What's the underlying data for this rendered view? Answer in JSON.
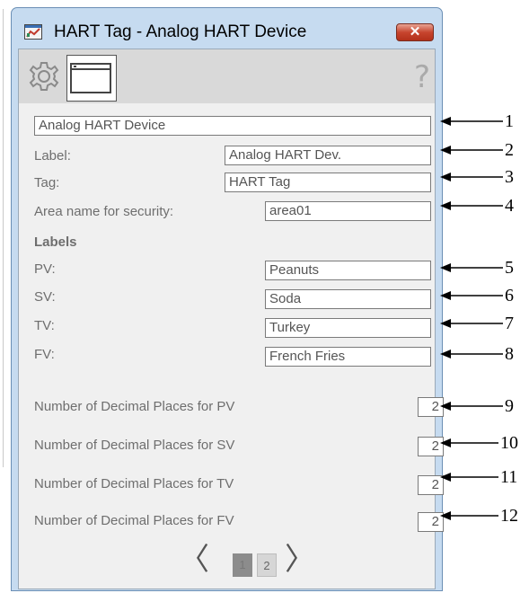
{
  "window": {
    "title": "HART Tag - Analog HART Device",
    "close_label": "✕"
  },
  "toolbar": {
    "gear_icon": "gear-icon",
    "window_icon": "window-icon",
    "help_label": "?"
  },
  "form": {
    "description": "Analog HART Device",
    "label_caption": "Label:",
    "label_value": "Analog HART Dev.",
    "tag_caption": "Tag:",
    "tag_value": "HART Tag",
    "area_caption": "Area name for security:",
    "area_value": "area01",
    "labels_heading": "Labels",
    "pv_caption": "PV:",
    "pv_value": "Peanuts",
    "sv_caption": "SV:",
    "sv_value": "Soda",
    "tv_caption": "TV:",
    "tv_value": "Turkey",
    "fv_caption": "FV:",
    "fv_value": "French Fries",
    "dec_pv_caption": "Number of Decimal Places for PV",
    "dec_pv_value": "2",
    "dec_sv_caption": "Number of Decimal Places for SV",
    "dec_sv_value": "2",
    "dec_tv_caption": "Number of Decimal Places for TV",
    "dec_tv_value": "2",
    "dec_fv_caption": "Number of Decimal Places for FV",
    "dec_fv_value": "2"
  },
  "pager": {
    "prev": "〈",
    "page1": "1",
    "page2": "2",
    "next": "〉"
  },
  "callouts": [
    "1",
    "2",
    "3",
    "4",
    "5",
    "6",
    "7",
    "8",
    "9",
    "10",
    "11",
    "12"
  ]
}
